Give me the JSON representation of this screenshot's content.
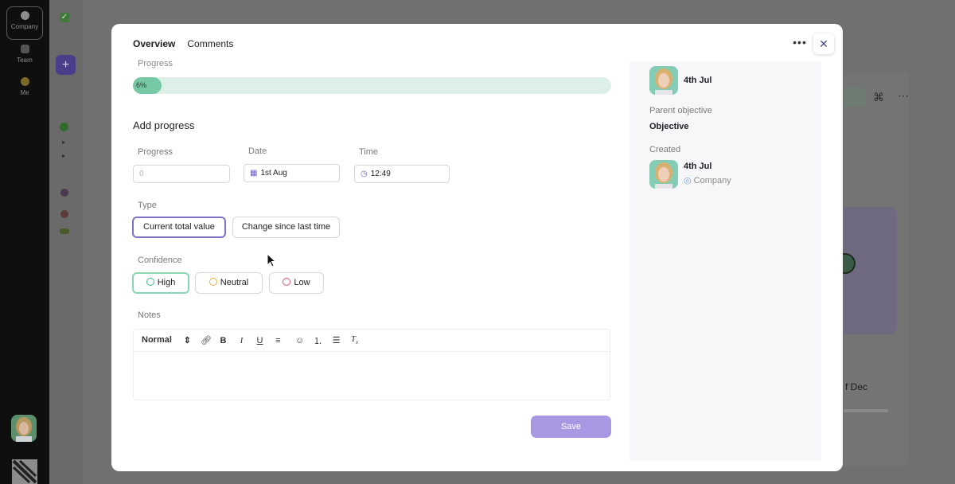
{
  "background": {
    "sidebar": {
      "items": [
        {
          "label": "Company"
        },
        {
          "label": "Team"
        },
        {
          "label": "Me"
        }
      ]
    },
    "add_button_label": "+",
    "dec_text": "f Dec"
  },
  "modal": {
    "tabs": [
      {
        "label": "Overview",
        "active": true
      },
      {
        "label": "Comments",
        "active": false
      }
    ],
    "progress": {
      "label": "Progress",
      "percent_text": "6%",
      "value": 0.06
    },
    "add_progress": {
      "title": "Add progress",
      "progress_field": {
        "label": "Progress",
        "placeholder": "0"
      },
      "date_field": {
        "label": "Date",
        "value": "1st Aug"
      },
      "time_field": {
        "label": "Time",
        "value": "12:49"
      },
      "type": {
        "label": "Type",
        "options": [
          "Current total value",
          "Change since last time"
        ],
        "selected": "Current total value"
      },
      "confidence": {
        "label": "Confidence",
        "options": [
          "High",
          "Neutral",
          "Low"
        ],
        "selected": "High"
      },
      "notes": {
        "label": "Notes",
        "format_value": "Normal"
      },
      "save_label": "Save"
    },
    "details": {
      "top_date": "4th Jul",
      "parent_objective_label": "Parent objective",
      "parent_objective_value": "Objective",
      "created_label": "Created",
      "created_date": "4th Jul",
      "created_scope": "Company"
    }
  },
  "colors": {
    "accent": "#7c72c8",
    "progress_fill": "#77c9a6",
    "progress_track": "#ddf0e8",
    "save_button": "#a898e4",
    "confidence_high": "#8cd5b3"
  }
}
